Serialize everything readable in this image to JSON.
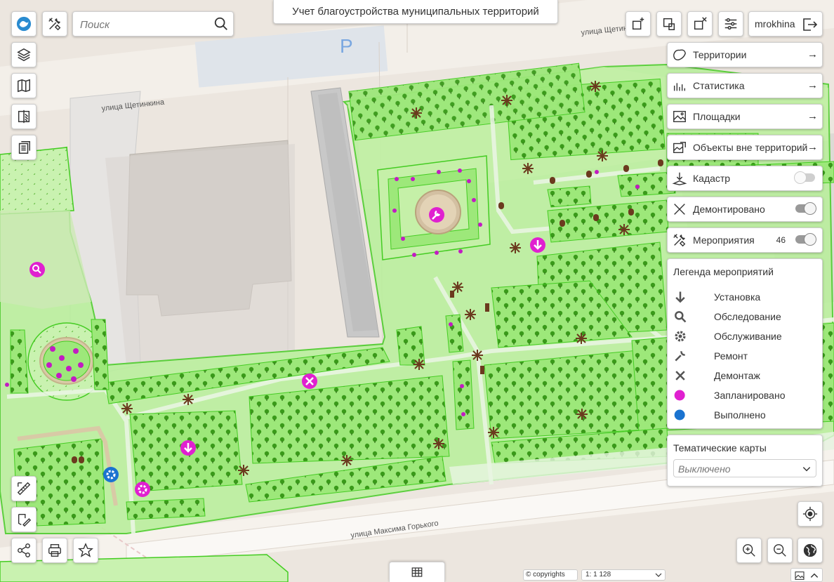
{
  "app": {
    "title": "Учет благоустройства муниципальных территорий",
    "search_placeholder": "Поиск",
    "username": "mrokhina"
  },
  "map": {
    "street_labels": [
      "улица Щетинкина",
      "улица Щетинкина",
      "улица Максима Горького"
    ],
    "parking_label": "P",
    "copyright": "© copyrights",
    "scale": "1: 1 128"
  },
  "panels": [
    {
      "id": "territories",
      "label": "Территории",
      "icon": "territory-icon",
      "control": "arrow"
    },
    {
      "id": "statistics",
      "label": "Статистика",
      "icon": "bar-chart-icon",
      "control": "arrow"
    },
    {
      "id": "playgrounds",
      "label": "Площадки",
      "icon": "image-icon",
      "control": "arrow"
    },
    {
      "id": "outside",
      "label": "Объекты вне территорий",
      "icon": "image-chart-icon",
      "control": "arrow"
    },
    {
      "id": "cadastre",
      "label": "Кадастр",
      "icon": "cadastre-icon",
      "control": "toggle",
      "state": "off"
    },
    {
      "id": "dismantled",
      "label": "Демонтировано",
      "icon": "cross-icon",
      "control": "toggle",
      "state": "on"
    },
    {
      "id": "events",
      "label": "Мероприятия",
      "icon": "tools-icon",
      "control": "toggle",
      "state": "on",
      "count": "46"
    }
  ],
  "arrow_glyph": "→",
  "legend": {
    "title": "Легенда мероприятий",
    "items": [
      {
        "label": "Установка",
        "icon": "arrow-down-icon"
      },
      {
        "label": "Обследование",
        "icon": "magnifier-icon"
      },
      {
        "label": "Обслуживание",
        "icon": "cog-icon"
      },
      {
        "label": "Ремонт",
        "icon": "wrench-icon"
      },
      {
        "label": "Демонтаж",
        "icon": "x-icon"
      },
      {
        "label": "Запланировано",
        "icon": "magenta-dot",
        "color": "#e020d0"
      },
      {
        "label": "Выполнено",
        "icon": "blue-dot",
        "color": "#1a73d0"
      }
    ]
  },
  "thematic": {
    "title": "Тематические карты",
    "value": "Выключено"
  },
  "colors": {
    "territory_fill": "#b8f09a",
    "lawn_fill": "#94e870",
    "territory_stroke": "#44cc22",
    "tree": "#3a9a1a",
    "planned": "#e020d0",
    "done": "#1a73d0",
    "asterisk": "#6b3a1e"
  }
}
